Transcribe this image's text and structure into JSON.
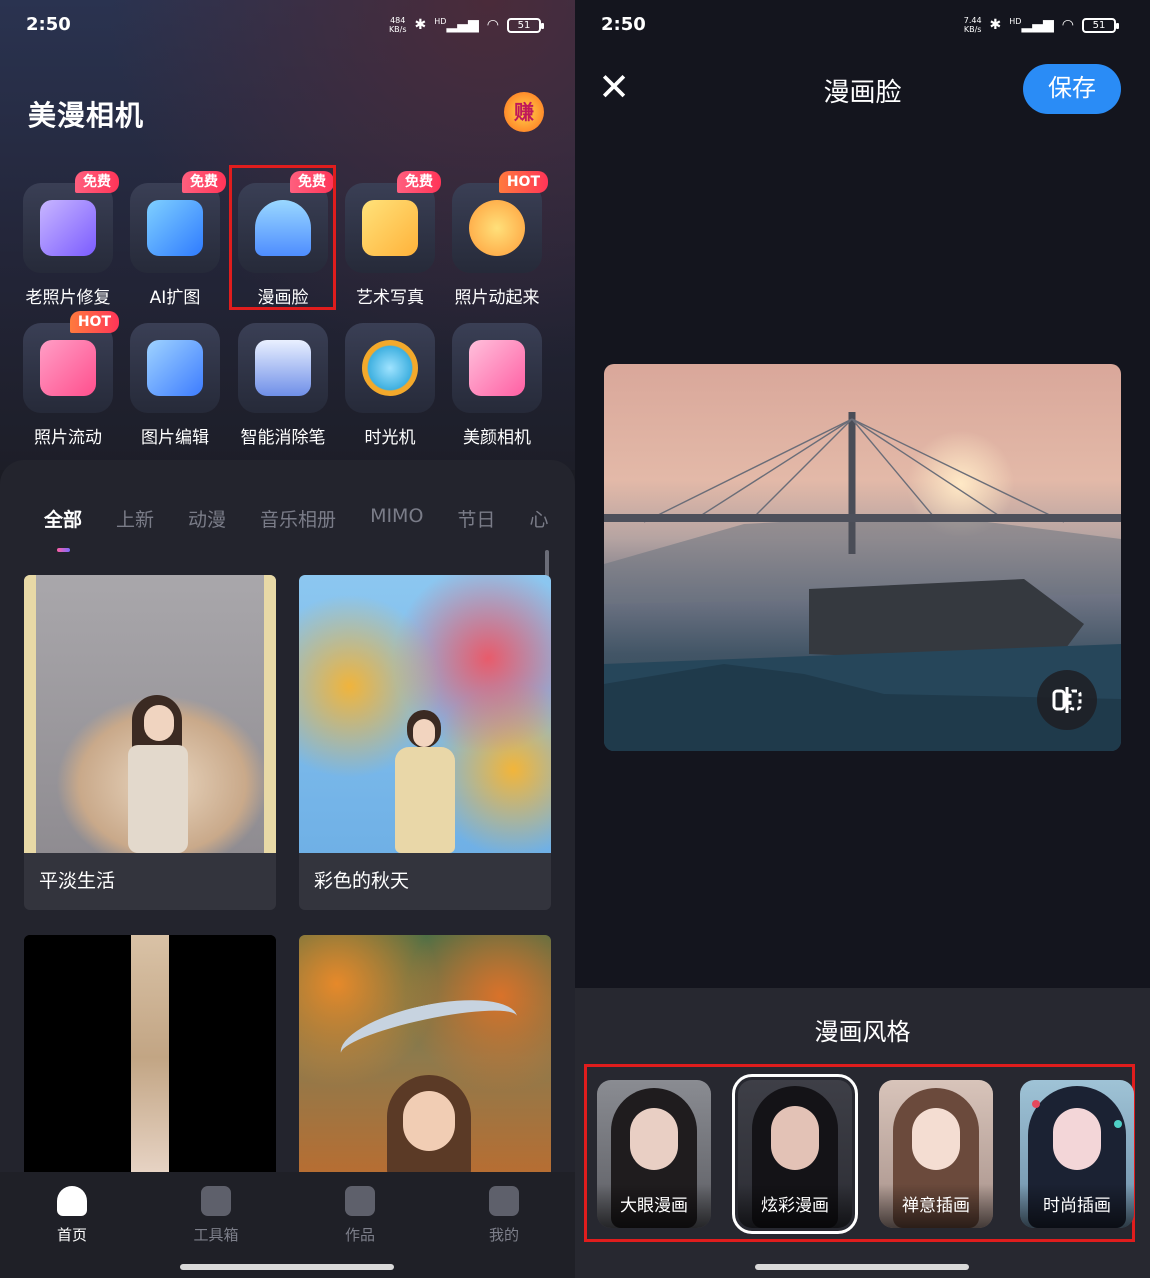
{
  "left": {
    "status": {
      "time": "2:50",
      "net_speed_value": "484",
      "net_speed_unit": "KB/s",
      "hd": "HD",
      "battery": "51"
    },
    "app_title": "美漫相机",
    "earn_badge": "赚",
    "tools": [
      {
        "label": "老照片修复",
        "tag": "免费",
        "icon": "photo-restore-icon"
      },
      {
        "label": "AI扩图",
        "tag": "免费",
        "icon": "expand-image-icon"
      },
      {
        "label": "漫画脸",
        "tag": "免费",
        "icon": "ghost-face-icon"
      },
      {
        "label": "艺术写真",
        "tag": "免费",
        "icon": "art-portrait-icon"
      },
      {
        "label": "照片动起来",
        "tag": "HOT",
        "icon": "animated-face-icon"
      },
      {
        "label": "照片流动",
        "tag": "HOT",
        "icon": "flow-wave-icon"
      },
      {
        "label": "图片编辑",
        "tag": "",
        "icon": "edit-pencil-icon"
      },
      {
        "label": "智能消除笔",
        "tag": "",
        "icon": "eraser-icon"
      },
      {
        "label": "时光机",
        "tag": "",
        "icon": "stopwatch-icon"
      },
      {
        "label": "美颜相机",
        "tag": "",
        "icon": "camera-icon"
      }
    ],
    "tabs": [
      "全部",
      "上新",
      "动漫",
      "音乐相册",
      "MIMO",
      "节日",
      "心"
    ],
    "cards": [
      {
        "caption": "平淡生活"
      },
      {
        "caption": "彩色的秋天"
      },
      {
        "caption": ""
      },
      {
        "caption": ""
      }
    ],
    "nav": [
      {
        "label": "首页",
        "icon": "home-icon"
      },
      {
        "label": "工具箱",
        "icon": "toolbox-icon"
      },
      {
        "label": "作品",
        "icon": "works-icon"
      },
      {
        "label": "我的",
        "icon": "profile-icon"
      }
    ]
  },
  "right": {
    "status": {
      "time": "2:50",
      "net_speed_value": "7.44",
      "net_speed_unit": "KB/s",
      "hd": "HD",
      "battery": "51"
    },
    "title": "漫画脸",
    "save_label": "保存",
    "panel_title": "漫画风格",
    "styles": [
      {
        "label": "大眼漫画"
      },
      {
        "label": "炫彩漫画"
      },
      {
        "label": "禅意插画"
      },
      {
        "label": "时尚插画"
      }
    ]
  }
}
